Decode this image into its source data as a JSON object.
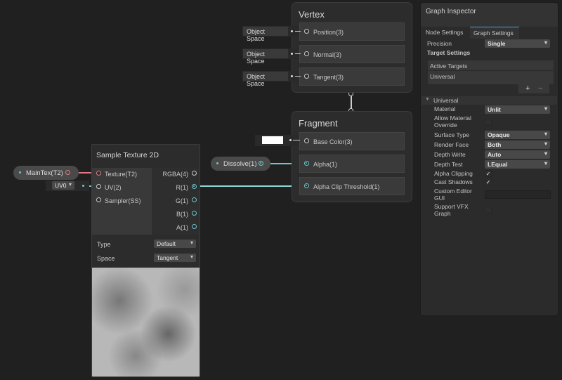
{
  "vertex": {
    "title": "Vertex",
    "ports": [
      {
        "label": "Position(3)",
        "input": "Object Space"
      },
      {
        "label": "Normal(3)",
        "input": "Object Space"
      },
      {
        "label": "Tangent(3)",
        "input": "Object Space"
      }
    ]
  },
  "fragment": {
    "title": "Fragment",
    "ports": [
      {
        "label": "Base Color(3)"
      },
      {
        "label": "Alpha(1)"
      },
      {
        "label": "Alpha Clip Threshold(1)"
      }
    ],
    "base_color": "#ffffff"
  },
  "dissolve": {
    "label": "Dissolve(1)"
  },
  "maintex": {
    "label": "MainTex(T2)"
  },
  "uv_select": {
    "value": "UV0"
  },
  "sample_texture": {
    "title": "Sample Texture 2D",
    "inputs": [
      "Texture(T2)",
      "UV(2)",
      "Sampler(SS)"
    ],
    "outputs": [
      "RGBA(4)",
      "R(1)",
      "G(1)",
      "B(1)",
      "A(1)"
    ],
    "type_label": "Type",
    "type_value": "Default",
    "space_label": "Space",
    "space_value": "Tangent"
  },
  "inspector": {
    "title": "Graph Inspector",
    "tabs": [
      "Node Settings",
      "Graph Settings"
    ],
    "precision_label": "Precision",
    "precision_value": "Single",
    "target_settings": "Target Settings",
    "active_targets": "Active Targets",
    "target_item": "Universal",
    "add": "+",
    "remove": "−",
    "section": "Universal",
    "props": [
      {
        "label": "Material",
        "value": "Unlit",
        "kind": "dd"
      },
      {
        "label": "Allow Material Override",
        "kind": "chk",
        "checked": false
      },
      {
        "label": "Surface Type",
        "value": "Opaque",
        "kind": "dd"
      },
      {
        "label": "Render Face",
        "value": "Both",
        "kind": "dd"
      },
      {
        "label": "Depth Write",
        "value": "Auto",
        "kind": "dd"
      },
      {
        "label": "Depth Test",
        "value": "LEqual",
        "kind": "dd"
      },
      {
        "label": "Alpha Clipping",
        "kind": "chk",
        "checked": true
      },
      {
        "label": "Cast Shadows",
        "kind": "chk",
        "checked": true
      },
      {
        "label": "Custom Editor GUI",
        "kind": "text",
        "value": ""
      },
      {
        "label": "Support VFX Graph",
        "kind": "chk",
        "checked": false
      }
    ]
  }
}
